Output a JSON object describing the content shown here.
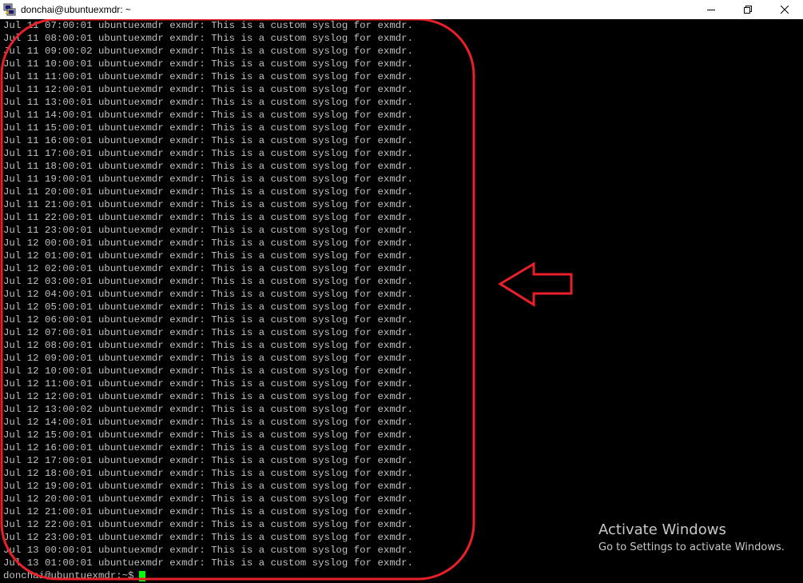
{
  "window": {
    "title": "donchai@ubuntuexmdr: ~",
    "app_icon": "putty-icon",
    "controls": [
      "minimize-icon",
      "restore-icon",
      "close-icon"
    ]
  },
  "terminal": {
    "lines": [
      "Jul 11 07:00:01 ubuntuexmdr exmdr: This is a custom syslog for exmdr.",
      "Jul 11 08:00:01 ubuntuexmdr exmdr: This is a custom syslog for exmdr.",
      "Jul 11 09:00:02 ubuntuexmdr exmdr: This is a custom syslog for exmdr.",
      "Jul 11 10:00:01 ubuntuexmdr exmdr: This is a custom syslog for exmdr.",
      "Jul 11 11:00:01 ubuntuexmdr exmdr: This is a custom syslog for exmdr.",
      "Jul 11 12:00:01 ubuntuexmdr exmdr: This is a custom syslog for exmdr.",
      "Jul 11 13:00:01 ubuntuexmdr exmdr: This is a custom syslog for exmdr.",
      "Jul 11 14:00:01 ubuntuexmdr exmdr: This is a custom syslog for exmdr.",
      "Jul 11 15:00:01 ubuntuexmdr exmdr: This is a custom syslog for exmdr.",
      "Jul 11 16:00:01 ubuntuexmdr exmdr: This is a custom syslog for exmdr.",
      "Jul 11 17:00:01 ubuntuexmdr exmdr: This is a custom syslog for exmdr.",
      "Jul 11 18:00:01 ubuntuexmdr exmdr: This is a custom syslog for exmdr.",
      "Jul 11 19:00:01 ubuntuexmdr exmdr: This is a custom syslog for exmdr.",
      "Jul 11 20:00:01 ubuntuexmdr exmdr: This is a custom syslog for exmdr.",
      "Jul 11 21:00:01 ubuntuexmdr exmdr: This is a custom syslog for exmdr.",
      "Jul 11 22:00:01 ubuntuexmdr exmdr: This is a custom syslog for exmdr.",
      "Jul 11 23:00:01 ubuntuexmdr exmdr: This is a custom syslog for exmdr.",
      "Jul 12 00:00:01 ubuntuexmdr exmdr: This is a custom syslog for exmdr.",
      "Jul 12 01:00:01 ubuntuexmdr exmdr: This is a custom syslog for exmdr.",
      "Jul 12 02:00:01 ubuntuexmdr exmdr: This is a custom syslog for exmdr.",
      "Jul 12 03:00:01 ubuntuexmdr exmdr: This is a custom syslog for exmdr.",
      "Jul 12 04:00:01 ubuntuexmdr exmdr: This is a custom syslog for exmdr.",
      "Jul 12 05:00:01 ubuntuexmdr exmdr: This is a custom syslog for exmdr.",
      "Jul 12 06:00:01 ubuntuexmdr exmdr: This is a custom syslog for exmdr.",
      "Jul 12 07:00:01 ubuntuexmdr exmdr: This is a custom syslog for exmdr.",
      "Jul 12 08:00:01 ubuntuexmdr exmdr: This is a custom syslog for exmdr.",
      "Jul 12 09:00:01 ubuntuexmdr exmdr: This is a custom syslog for exmdr.",
      "Jul 12 10:00:01 ubuntuexmdr exmdr: This is a custom syslog for exmdr.",
      "Jul 12 11:00:01 ubuntuexmdr exmdr: This is a custom syslog for exmdr.",
      "Jul 12 12:00:01 ubuntuexmdr exmdr: This is a custom syslog for exmdr.",
      "Jul 12 13:00:02 ubuntuexmdr exmdr: This is a custom syslog for exmdr.",
      "Jul 12 14:00:01 ubuntuexmdr exmdr: This is a custom syslog for exmdr.",
      "Jul 12 15:00:01 ubuntuexmdr exmdr: This is a custom syslog for exmdr.",
      "Jul 12 16:00:01 ubuntuexmdr exmdr: This is a custom syslog for exmdr.",
      "Jul 12 17:00:01 ubuntuexmdr exmdr: This is a custom syslog for exmdr.",
      "Jul 12 18:00:01 ubuntuexmdr exmdr: This is a custom syslog for exmdr.",
      "Jul 12 19:00:01 ubuntuexmdr exmdr: This is a custom syslog for exmdr.",
      "Jul 12 20:00:01 ubuntuexmdr exmdr: This is a custom syslog for exmdr.",
      "Jul 12 21:00:01 ubuntuexmdr exmdr: This is a custom syslog for exmdr.",
      "Jul 12 22:00:01 ubuntuexmdr exmdr: This is a custom syslog for exmdr.",
      "Jul 12 23:00:01 ubuntuexmdr exmdr: This is a custom syslog for exmdr.",
      "Jul 13 00:00:01 ubuntuexmdr exmdr: This is a custom syslog for exmdr.",
      "Jul 13 01:00:01 ubuntuexmdr exmdr: This is a custom syslog for exmdr."
    ],
    "prompt": "donchai@ubuntuexmdr:~$",
    "text_color": "#c0c0c0",
    "cursor_color": "#00ff00"
  },
  "annotation": {
    "color": "#e8202a",
    "shapes": [
      "rounded-rectangle-highlight",
      "left-arrow-icon"
    ]
  },
  "watermark": {
    "title": "Activate Windows",
    "subtitle": "Go to Settings to activate Windows."
  }
}
